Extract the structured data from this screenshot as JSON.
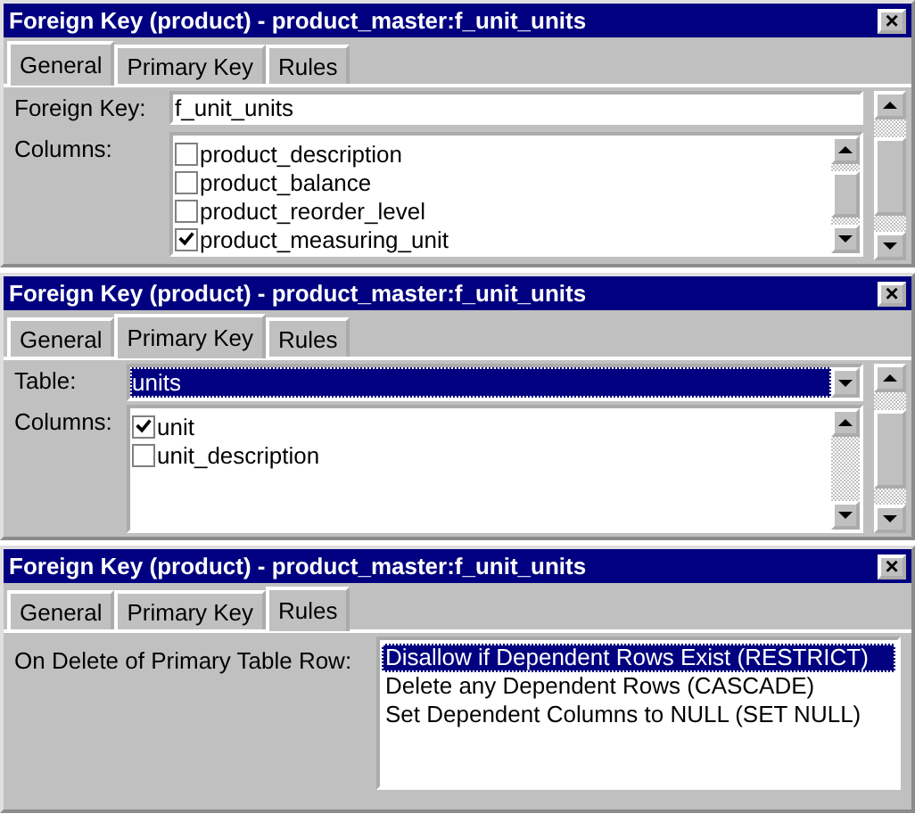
{
  "windows": [
    {
      "kind": "general",
      "title": "Foreign Key (product) - product_master:f_unit_units",
      "close": "×",
      "tabs": [
        {
          "label": "General",
          "selected": true
        },
        {
          "label": "Primary Key",
          "selected": false
        },
        {
          "label": "Rules",
          "selected": false
        }
      ],
      "foreign_key_label": "Foreign Key:",
      "foreign_key_value": "f_unit_units",
      "columns_label": "Columns:",
      "columns": [
        {
          "name": "product_description",
          "checked": false
        },
        {
          "name": "product_balance",
          "checked": false
        },
        {
          "name": "product_reorder_level",
          "checked": false
        },
        {
          "name": "product_measuring_unit",
          "checked": true
        }
      ]
    },
    {
      "kind": "primary_key",
      "title": "Foreign Key (product) - product_master:f_unit_units",
      "close": "×",
      "tabs": [
        {
          "label": "General",
          "selected": false
        },
        {
          "label": "Primary Key",
          "selected": true
        },
        {
          "label": "Rules",
          "selected": false
        }
      ],
      "table_label": "Table:",
      "table_value": "units",
      "columns_label": "Columns:",
      "columns": [
        {
          "name": "unit",
          "checked": true
        },
        {
          "name": "unit_description",
          "checked": false
        }
      ]
    },
    {
      "kind": "rules",
      "title": "Foreign Key (product) - product_master:f_unit_units",
      "close": "×",
      "tabs": [
        {
          "label": "General",
          "selected": false
        },
        {
          "label": "Primary Key",
          "selected": false
        },
        {
          "label": "Rules",
          "selected": true
        }
      ],
      "on_delete_label": "On Delete of Primary Table Row:",
      "options": [
        {
          "label": "Disallow if Dependent Rows Exist (RESTRICT)",
          "selected": true
        },
        {
          "label": "Delete any Dependent Rows (CASCADE)",
          "selected": false
        },
        {
          "label": "Set Dependent Columns to NULL (SET NULL)",
          "selected": false
        }
      ]
    }
  ]
}
